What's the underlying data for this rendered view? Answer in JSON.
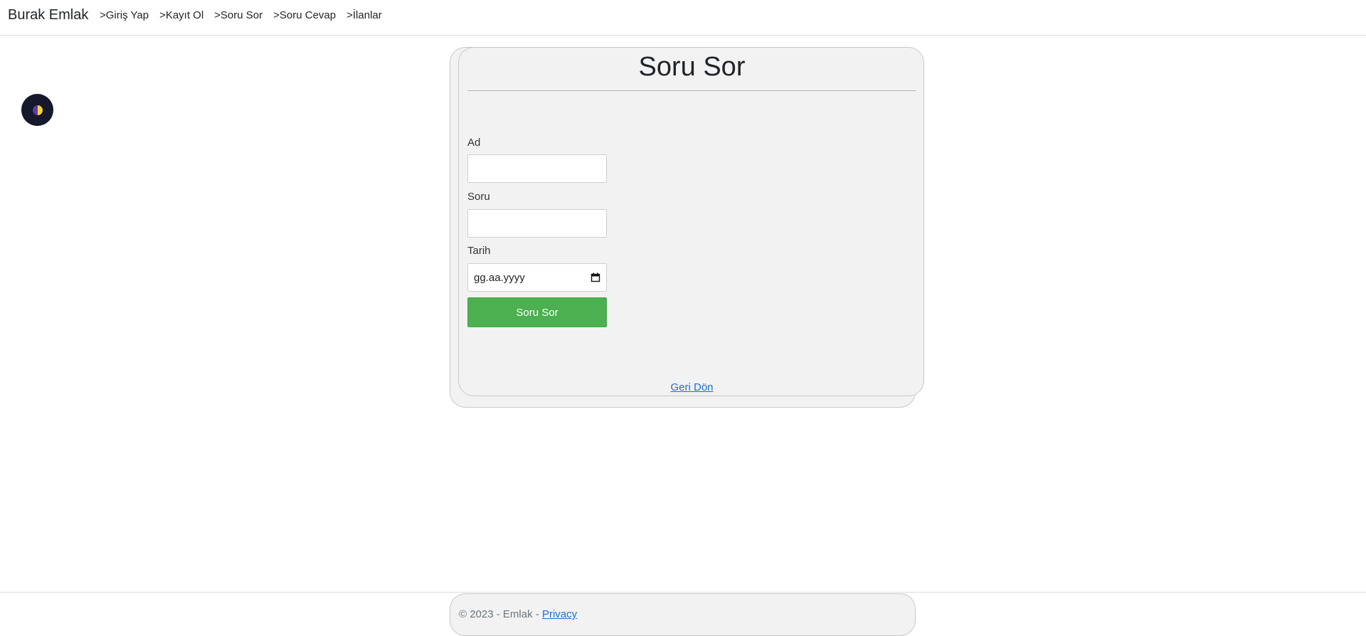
{
  "navbar": {
    "brand": "Burak Emlak",
    "links": [
      {
        "label": ">Giriş Yap"
      },
      {
        "label": ">Kayıt Ol"
      },
      {
        "label": ">Soru Sor"
      },
      {
        "label": ">Soru Cevap"
      },
      {
        "label": ">İlanlar"
      }
    ]
  },
  "theme_toggle": {
    "icon": "half-moon-contrast-icon",
    "colors": {
      "background": "#16182b",
      "left": "#5b3fa0",
      "right": "#f5d33d"
    }
  },
  "card": {
    "title": "Soru Sor",
    "fields": [
      {
        "label": "Ad",
        "value": ""
      },
      {
        "label": "Soru",
        "value": ""
      },
      {
        "label": "Tarih",
        "placeholder": "gg.aa.yyyy"
      }
    ],
    "submit_label": "Soru Sor",
    "back_label": "Geri Dön"
  },
  "footer": {
    "copyright": "© 2023 - Emlak - ",
    "privacy_label": "Privacy"
  },
  "colors": {
    "accent_green": "#4caf50",
    "link_blue": "#1a6fd1",
    "card_bg": "#f2f2f2"
  }
}
